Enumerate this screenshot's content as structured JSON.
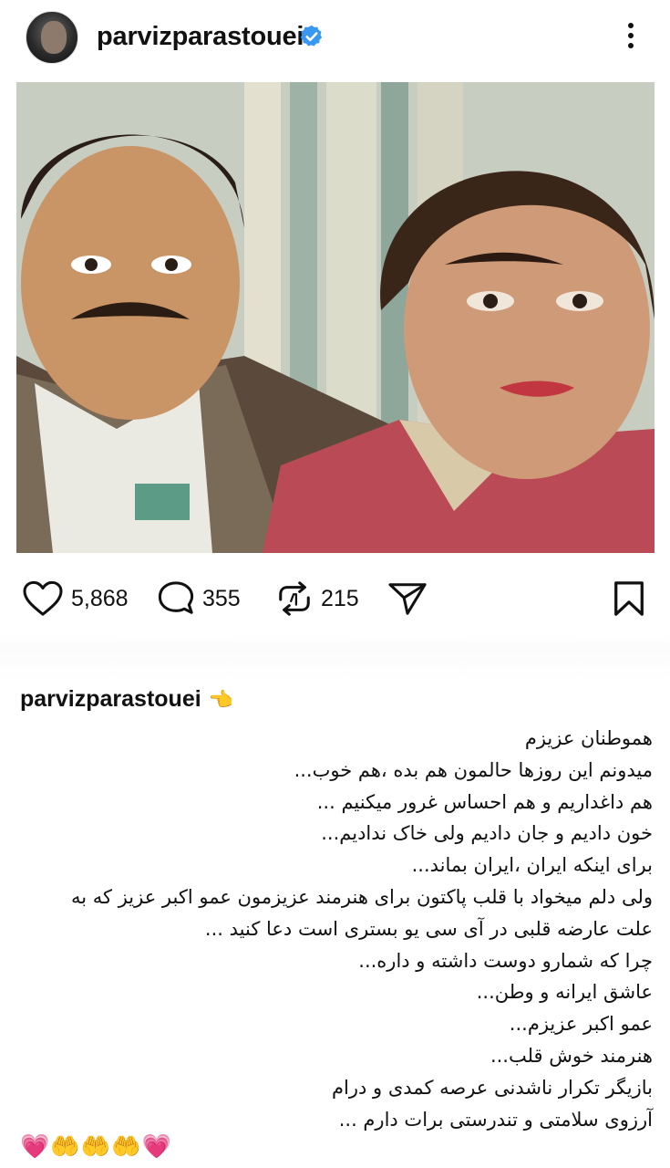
{
  "post": {
    "username": "parvizparastouei",
    "verified": true,
    "avatar": "avatar",
    "likes": "5,868",
    "comments": "355",
    "reposts": "215"
  },
  "icons": {
    "like": "heart-icon",
    "comment": "comment-bubble-icon",
    "repost": "repost-icon",
    "share": "send-icon",
    "save": "bookmark-icon",
    "more": "more-options-icon",
    "verified": "verified-badge-icon"
  },
  "colors": {
    "verified_blue": "#3897f0",
    "text": "#111111",
    "background": "#ffffff"
  },
  "caption": {
    "username": "parvizparastouei",
    "hand_emoji": "👈",
    "lines": [
      "هموطنان عزیزم",
      "میدونم این روزها حالمون هم بده ،هم خوب...",
      "هم داغداریم و هم احساس غرور میکنیم ...",
      "خون دادیم و جان دادیم ولی خاک ندادیم...",
      "برای اینکه ایران ،ایران بماند...",
      "ولی دلم میخواد با قلب پاکتون برای هنرمند عزیزمون عمو اکبر عزیز که به",
      "علت عارضه قلبی در آی سی یو بستری است دعا کنید ...",
      "چرا که شمارو دوست داشته و  داره...",
      "عاشق ایرانه و وطن...",
      "عمو اکبر عزیزم...",
      "هنرمند خوش قلب...",
      "بازیگر تکرار ناشدنی  عرصه  کمدی و درام",
      "آرزوی سلامتی و تندرستی برات دارم ..."
    ],
    "emojis": "💗🤲🤲🤲💗"
  }
}
